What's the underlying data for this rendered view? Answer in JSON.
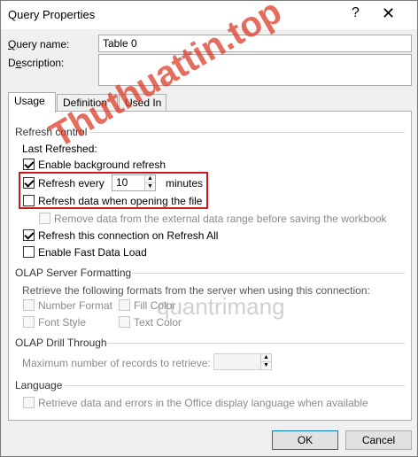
{
  "window": {
    "title": "Query Properties",
    "help_glyph": "?",
    "close_glyph": "✕"
  },
  "fields": {
    "query_name_label": "Query name:",
    "query_name_value": "Table 0",
    "description_label": "Description:",
    "description_value": ""
  },
  "tabs": [
    "Usage",
    "Definition",
    "Used In"
  ],
  "refresh_control": {
    "title": "Refresh control",
    "last_refreshed": "Last Refreshed:",
    "background_refresh": {
      "label": "Enable background refresh",
      "checked": true
    },
    "refresh_every": {
      "label": "Refresh every",
      "checked": true,
      "value": "10",
      "unit": "minutes"
    },
    "refresh_on_open": {
      "label": "Refresh data when opening the file",
      "checked": false
    },
    "remove_data": {
      "label": "Remove data from the external data range before saving the workbook",
      "checked": false,
      "disabled": true
    },
    "refresh_all": {
      "label": "Refresh this connection on Refresh All",
      "checked": true
    },
    "fast_load": {
      "label": "Enable Fast Data Load",
      "checked": false
    }
  },
  "olap_formatting": {
    "title": "OLAP Server Formatting",
    "desc": "Retrieve the following formats from the server when using this connection:",
    "number_format": "Number Format",
    "fill_color": "Fill Color",
    "font_style": "Font Style",
    "text_color": "Text Color"
  },
  "olap_drill": {
    "title": "OLAP Drill Through",
    "max_records_label": "Maximum number of records to retrieve:",
    "max_records_value": ""
  },
  "language": {
    "title": "Language",
    "retrieve_label": "Retrieve data and errors in the Office display language when available"
  },
  "buttons": {
    "ok": "OK",
    "cancel": "Cancel"
  },
  "watermarks": {
    "top": "Thuthuattin.top",
    "center": "quantrimang"
  },
  "colors": {
    "highlight": "#cc1a1a",
    "ok_border": "#0078d7"
  }
}
